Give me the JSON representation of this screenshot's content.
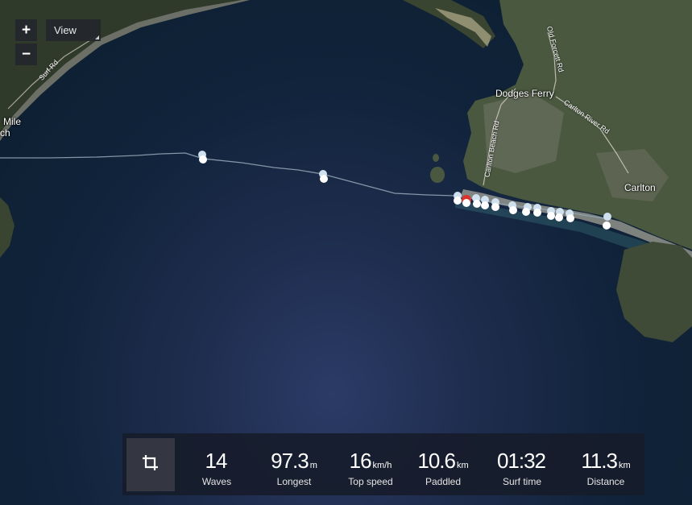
{
  "map": {
    "zoom_in_label": "+",
    "zoom_out_label": "−",
    "view_label": "View",
    "labels": {
      "dodges_ferry": "Dodges Ferry",
      "carlton": "Carlton",
      "mile": "Mile",
      "ch": "ch",
      "surf_rd": "Surf Rd",
      "old_forcett_rd": "Old Forcett Rd",
      "carlton_river_rd": "Carlton River Rd",
      "carlton_beach_rd": "Carlton Beach Rd"
    },
    "colors": {
      "track": "#8fa3b3",
      "wave_marker": "#ffffff",
      "selected_marker": "#d9332b",
      "water": "#1b2b48",
      "land": "#3d4a36"
    }
  },
  "stats": {
    "crop_icon": "crop-icon",
    "items": [
      {
        "value": "14",
        "unit": "",
        "label": "Waves"
      },
      {
        "value": "97.3",
        "unit": "m",
        "label": "Longest"
      },
      {
        "value": "16",
        "unit": "km/h",
        "label": "Top speed"
      },
      {
        "value": "10.6",
        "unit": "km",
        "label": "Paddled"
      },
      {
        "value": "01:32",
        "unit": "",
        "label": "Surf time"
      },
      {
        "value": "11.3",
        "unit": "km",
        "label": "Distance"
      }
    ]
  }
}
